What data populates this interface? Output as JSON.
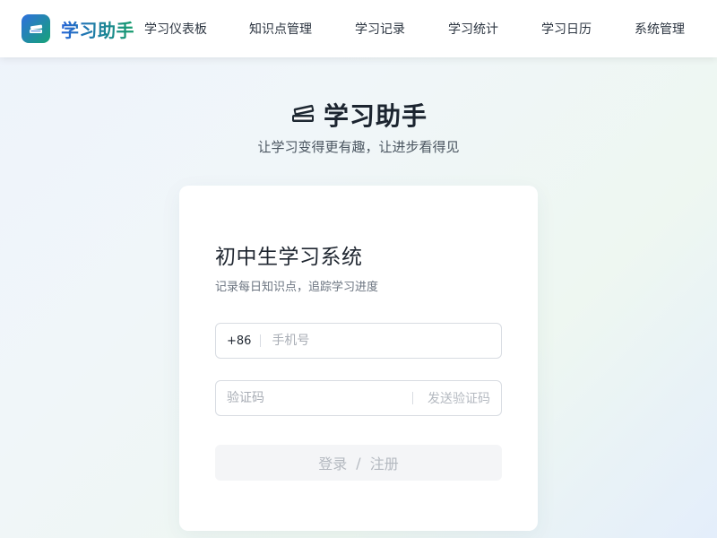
{
  "header": {
    "logo_icon": "books-icon",
    "brand": "学习助手",
    "nav": [
      {
        "label": "学习仪表板",
        "name": "nav-dashboard"
      },
      {
        "label": "知识点管理",
        "name": "nav-knowledge"
      },
      {
        "label": "学习记录",
        "name": "nav-records"
      },
      {
        "label": "学习统计",
        "name": "nav-statistics"
      },
      {
        "label": "学习日历",
        "name": "nav-calendar"
      },
      {
        "label": "系统管理",
        "name": "nav-system"
      }
    ]
  },
  "hero": {
    "icon": "books-icon",
    "title": "学习助手",
    "subtitle": "让学习变得更有趣，让进步看得见"
  },
  "login": {
    "title": "初中生学习系统",
    "subtitle": "记录每日知识点，追踪学习进度",
    "phone_prefix": "+86",
    "phone_placeholder": "手机号",
    "phone_value": "",
    "code_placeholder": "验证码",
    "code_value": "",
    "send_code_label": "发送验证码",
    "submit_login": "登录",
    "submit_sep": "/",
    "submit_register": "注册"
  },
  "colors": {
    "brand_blue": "#2463d6",
    "brand_green": "#159c6a",
    "button_disabled_bg": "#f4f5f7",
    "button_disabled_text": "#b4b9c0"
  }
}
